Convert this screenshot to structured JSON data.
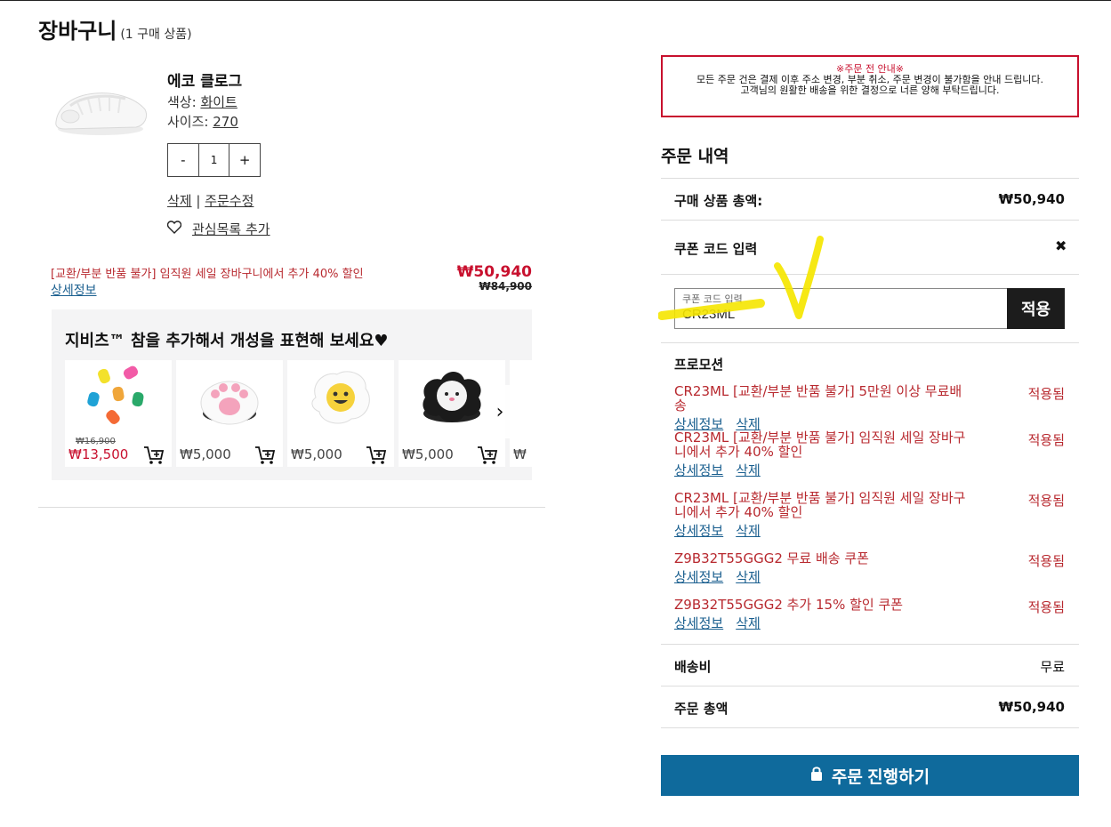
{
  "header": {
    "title": "장바구니",
    "count": "(1 구매 상품)"
  },
  "product": {
    "name": "에코 클로그",
    "color_label": "색상: ",
    "color_value": "화이트",
    "size_label": "사이즈: ",
    "size_value": "270",
    "qty_minus": "-",
    "qty_value": "1",
    "qty_plus": "+",
    "delete_label": "삭제",
    "sep": " | ",
    "edit_label": "주문수정",
    "wishlist_label": "관심목록 추가",
    "promo_text": "[교환/부분 반품 불가] 임직원 세일 장바구니에서 추가 40% 할인",
    "promo_detail": "상세정보",
    "price_now": "₩50,940",
    "price_was": "₩84,900"
  },
  "charms": {
    "title": "지비츠™ 참을 추가해서 개성을 표현해 보세요♥",
    "items": [
      {
        "old_price": "₩16,900",
        "price": "₩13,500",
        "icon": "gummy-bears-charm"
      },
      {
        "old_price": "",
        "price": "₩5,000",
        "icon": "paw-charm"
      },
      {
        "old_price": "",
        "price": "₩5,000",
        "icon": "egg-smiley-charm"
      },
      {
        "old_price": "",
        "price": "₩5,000",
        "icon": "panda-cloud-charm"
      },
      {
        "old_price": "",
        "price": "₩",
        "icon": "partial-charm"
      }
    ],
    "next": "›"
  },
  "notice": {
    "title": "※주문 전 안내※",
    "line1": "모든 주문 건은 결제 이후 주소 변경, 부분 취소, 주문 변경이 불가함을 안내 드립니다.",
    "line2": "고객님의 원활한 배송을 위한 결정으로 너른 양해 부탁드립니다."
  },
  "summary": {
    "title": "주문 내역",
    "subtotal_label": "구매 상품 총액:",
    "subtotal_value": "₩50,940",
    "coupon_label": "쿠폰 코드 입력",
    "coupon_close": "✖",
    "coupon_placeholder": "쿠폰 코드 입력",
    "coupon_value": "CR23ML",
    "apply_label": "적용",
    "promotions_title": "프로모션",
    "promotions": [
      {
        "name": "CR23ML [교환/부분 반품 불가] 5만원 이상 무료배송",
        "status": "적용됨",
        "detail": "상세정보",
        "delete": "삭제"
      },
      {
        "name": "CR23ML [교환/부분 반품 불가] 임직원 세일 장바구니에서 추가 40% 할인",
        "status": "적용됨",
        "detail": "상세정보",
        "delete": "삭제"
      },
      {
        "name": "CR23ML [교환/부분 반품 불가] 임직원 세일 장바구니에서 추가 40% 할인",
        "status": "적용됨",
        "detail": "상세정보",
        "delete": "삭제"
      },
      {
        "name": "Z9B32T55GGG2 무료 배송 쿠폰",
        "status": "적용됨",
        "detail": "상세정보",
        "delete": "삭제"
      },
      {
        "name": "Z9B32T55GGG2 추가 15% 할인 쿠폰",
        "status": "적용됨",
        "detail": "상세정보",
        "delete": "삭제"
      }
    ],
    "shipping_label": "배송비",
    "shipping_value": "무료",
    "total_label": "주문 총액",
    "total_value": "₩50,940",
    "checkout_label": "주문 진행하기"
  },
  "colors": {
    "accent": "#0f6a9c",
    "sale": "#c8102e",
    "annotation": "#f5e600"
  }
}
